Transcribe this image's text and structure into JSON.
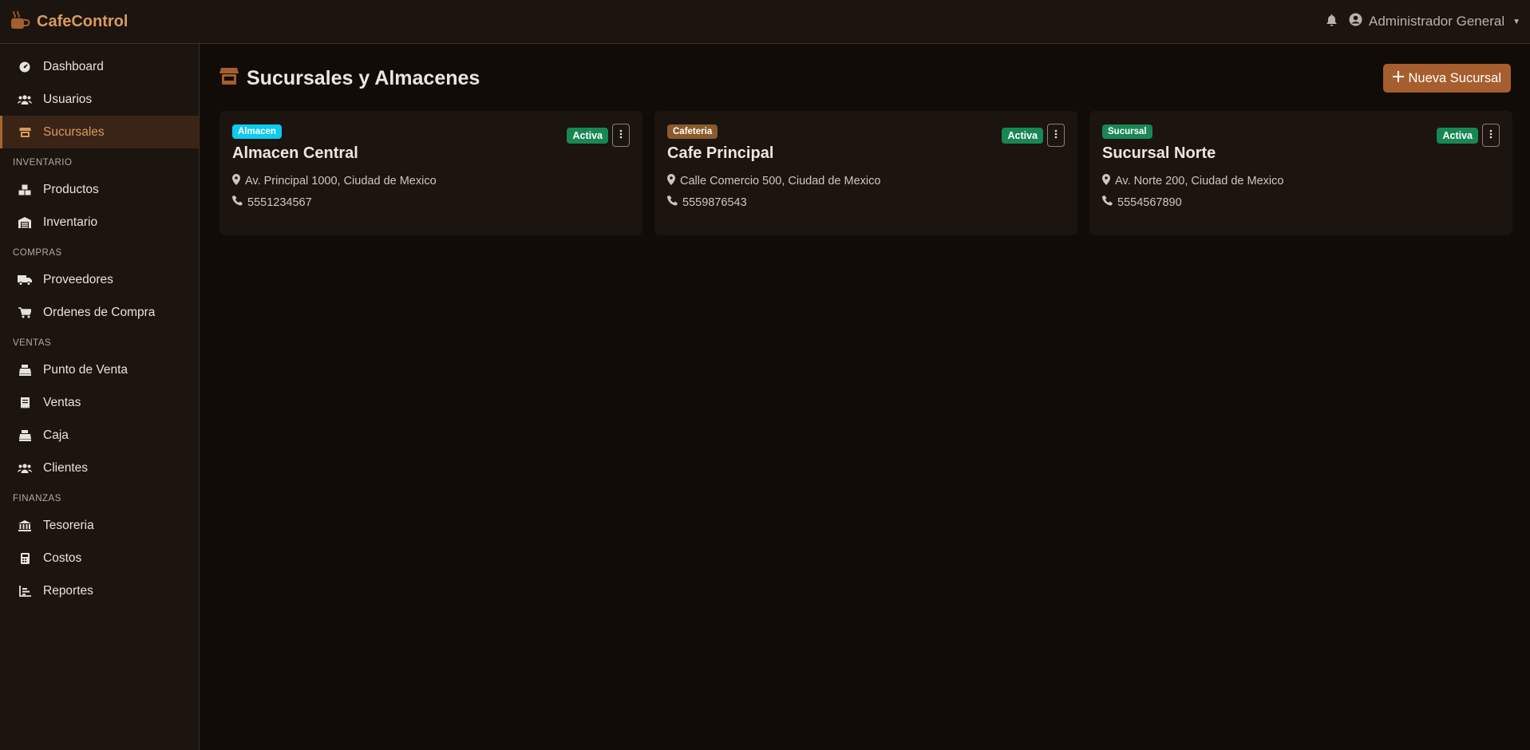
{
  "app": {
    "brand": "CafeControl",
    "icon": "coffee-mug-icon",
    "user_name": "Administrador General"
  },
  "sidebar": {
    "items_top": [
      {
        "label": "Dashboard",
        "icon": "gauge-icon"
      },
      {
        "label": "Usuarios",
        "icon": "users-icon"
      },
      {
        "label": "Sucursales",
        "icon": "store-icon",
        "active": true
      }
    ],
    "sections": [
      {
        "label": "INVENTARIO",
        "items": [
          {
            "label": "Productos",
            "icon": "boxes-icon"
          },
          {
            "label": "Inventario",
            "icon": "warehouse-icon"
          }
        ]
      },
      {
        "label": "COMPRAS",
        "items": [
          {
            "label": "Proveedores",
            "icon": "truck-icon"
          },
          {
            "label": "Ordenes de Compra",
            "icon": "cart-icon"
          }
        ]
      },
      {
        "label": "VENTAS",
        "items": [
          {
            "label": "Punto de Venta",
            "icon": "cash-register-icon"
          },
          {
            "label": "Ventas",
            "icon": "receipt-icon"
          },
          {
            "label": "Caja",
            "icon": "cash-box-icon"
          },
          {
            "label": "Clientes",
            "icon": "clients-icon"
          }
        ]
      },
      {
        "label": "FINANZAS",
        "items": [
          {
            "label": "Tesoreria",
            "icon": "bank-icon"
          },
          {
            "label": "Costos",
            "icon": "calculator-icon"
          },
          {
            "label": "Reportes",
            "icon": "chart-icon"
          }
        ]
      }
    ]
  },
  "main": {
    "title": "Sucursales y Almacenes",
    "new_button_label": "Nueva Sucursal",
    "branches": [
      {
        "type": "Almacen",
        "type_color": "#0dcaf0",
        "name": "Almacen Central",
        "status": "Activa",
        "address": "Av. Principal 1000, Ciudad de Mexico",
        "phone": "5551234567"
      },
      {
        "type": "Cafeteria",
        "type_color": "#8b5a2b",
        "name": "Cafe Principal",
        "status": "Activa",
        "address": "Calle Comercio 500, Ciudad de Mexico",
        "phone": "5559876543"
      },
      {
        "type": "Sucursal",
        "type_color": "#198754",
        "name": "Sucursal Norte",
        "status": "Activa",
        "address": "Av. Norte 200, Ciudad de Mexico",
        "phone": "5554567890"
      }
    ]
  },
  "colors": {
    "accent": "#d99a5b",
    "button": "#a65e2e",
    "status_active": "#198754",
    "background": "#110c08",
    "panel": "#1b140f"
  }
}
